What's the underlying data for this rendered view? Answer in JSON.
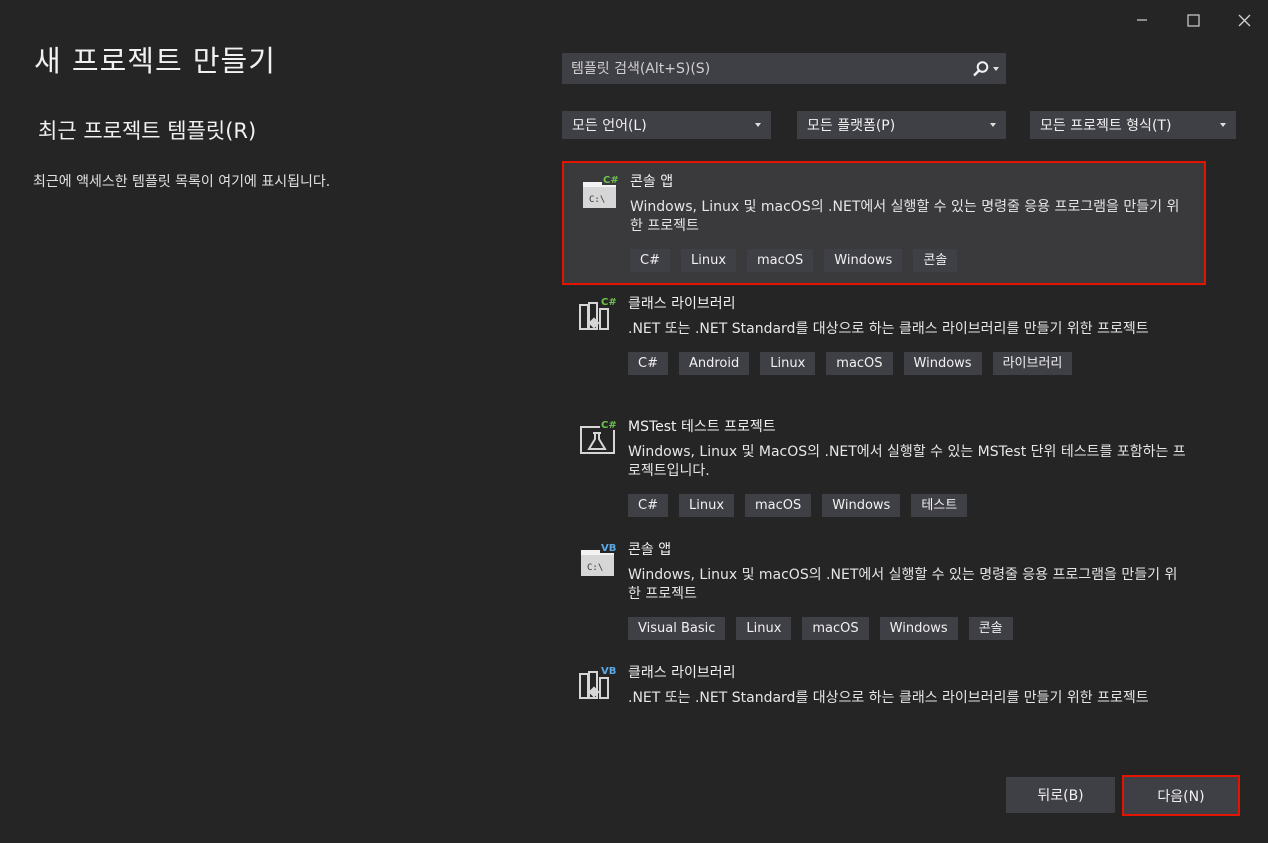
{
  "window": {
    "minimize": "–",
    "maximize": "☐",
    "close": "✕"
  },
  "page_title": "새 프로젝트 만들기",
  "recent": {
    "title": "최근 프로젝트 템플릿(R)",
    "empty_text": "최근에 액세스한 템플릿 목록이 여기에 표시됩니다."
  },
  "search": {
    "placeholder": "템플릿 검색(Alt+S)(S)",
    "value": "",
    "icon": "search-icon"
  },
  "filters": {
    "language": "모든 언어(L)",
    "platform": "모든 플랫폼(P)",
    "project_type": "모든 프로젝트 형식(T)"
  },
  "templates": [
    {
      "title": "콘솔 앱",
      "desc": "Windows, Linux 및 macOS의 .NET에서 실행할 수 있는 명령줄 응용 프로그램을 만들기 위한 프로젝트",
      "tags": [
        "C#",
        "Linux",
        "macOS",
        "Windows",
        "콘솔"
      ],
      "lang_badge": "C#",
      "icon": "console-app-icon",
      "selected": true
    },
    {
      "title": "클래스 라이브러리",
      "desc": ".NET 또는 .NET Standard를 대상으로 하는 클래스 라이브러리를 만들기 위한 프로젝트",
      "tags": [
        "C#",
        "Android",
        "Linux",
        "macOS",
        "Windows",
        "라이브러리"
      ],
      "lang_badge": "C#",
      "icon": "class-library-icon",
      "selected": false
    },
    {
      "title": "MSTest 테스트 프로젝트",
      "desc": "Windows, Linux 및 MacOS의 .NET에서 실행할 수 있는 MSTest 단위 테스트를 포함하는 프로젝트입니다.",
      "tags": [
        "C#",
        "Linux",
        "macOS",
        "Windows",
        "테스트"
      ],
      "lang_badge": "C#",
      "icon": "test-project-icon",
      "selected": false
    },
    {
      "title": "콘솔 앱",
      "desc": "Windows, Linux 및 macOS의 .NET에서 실행할 수 있는 명령줄 응용 프로그램을 만들기 위한 프로젝트",
      "tags": [
        "Visual Basic",
        "Linux",
        "macOS",
        "Windows",
        "콘솔"
      ],
      "lang_badge": "VB",
      "icon": "console-app-icon",
      "selected": false
    },
    {
      "title": "클래스 라이브러리",
      "desc": ".NET 또는 .NET Standard를 대상으로 하는 클래스 라이브러리를 만들기 위한 프로젝트",
      "tags": [],
      "lang_badge": "VB",
      "icon": "class-library-icon",
      "selected": false
    }
  ],
  "buttons": {
    "back": "뒤로(B)",
    "next": "다음(N)"
  },
  "colors": {
    "background": "#252526",
    "control": "#3f3f46",
    "highlight": "#e51400",
    "csharp_badge": "#6cc24a",
    "vb_badge": "#5aa9e6"
  }
}
